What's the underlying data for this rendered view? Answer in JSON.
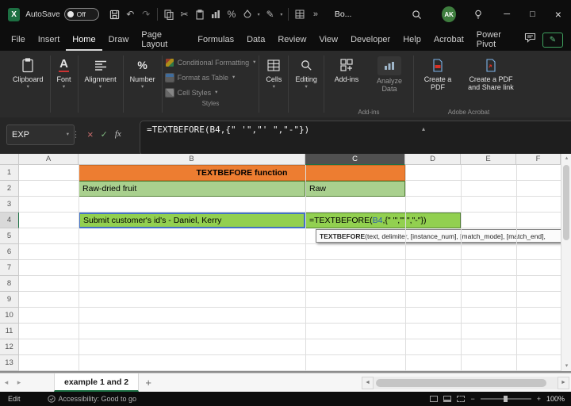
{
  "title_bar": {
    "autosave_label": "AutoSave",
    "autosave_state": "Off",
    "workbook_name": "Bo...",
    "avatar_initials": "AK"
  },
  "menu_bar": {
    "items": [
      "File",
      "Insert",
      "Home",
      "Draw",
      "Page Layout",
      "Formulas",
      "Data",
      "Review",
      "View",
      "Developer",
      "Help",
      "Acrobat",
      "Power Pivot"
    ],
    "active_item": "Home"
  },
  "ribbon": {
    "buttons": {
      "clipboard": "Clipboard",
      "font": "Font",
      "alignment": "Alignment",
      "number": "Number",
      "cells": "Cells",
      "editing": "Editing",
      "addins": "Add-ins",
      "analyze": "Analyze Data",
      "create_pdf": "Create a PDF",
      "create_share": "Create a PDF and Share link"
    },
    "styles_menu": [
      "Conditional Formatting",
      "Format as Table",
      "Cell Styles"
    ],
    "group_labels": {
      "styles": "Styles",
      "addins": "Add-ins",
      "acrobat": "Adobe Acrobat"
    }
  },
  "formula_bar": {
    "name_box": "EXP",
    "formula": "=TEXTBEFORE(B4,{\" '\",\"' \",\"-\"})",
    "fx_label": "fx"
  },
  "grid": {
    "column_headers": [
      "A",
      "B",
      "C",
      "D",
      "E",
      "F"
    ],
    "selected_column": "C",
    "row_headers": [
      "1",
      "2",
      "3",
      "4",
      "5",
      "6",
      "7",
      "8",
      "9",
      "10",
      "11",
      "12",
      "13"
    ],
    "selected_row": "4",
    "cells": {
      "title_b1": "TEXTBEFORE function",
      "b2": "Raw-dried fruit",
      "c2": "Raw",
      "b4": "Submit customer's id's - Daniel, Kerry",
      "c4_formula_prefix": "=TEXTBEFORE(",
      "c4_formula_ref": "B4",
      "c4_formula_suffix": ",{\" '\",\"' \",\"-\"})"
    },
    "tooltip": {
      "function_name": "TEXTBEFORE",
      "signature": "(text, delimiter, [instance_num], [match_mode], [match_end],"
    }
  },
  "sheet_tabs": {
    "active_tab": "example 1 and 2",
    "add_label": "+"
  },
  "status_bar": {
    "mode": "Edit",
    "accessibility": "Accessibility: Good to go",
    "zoom": "100%"
  }
}
